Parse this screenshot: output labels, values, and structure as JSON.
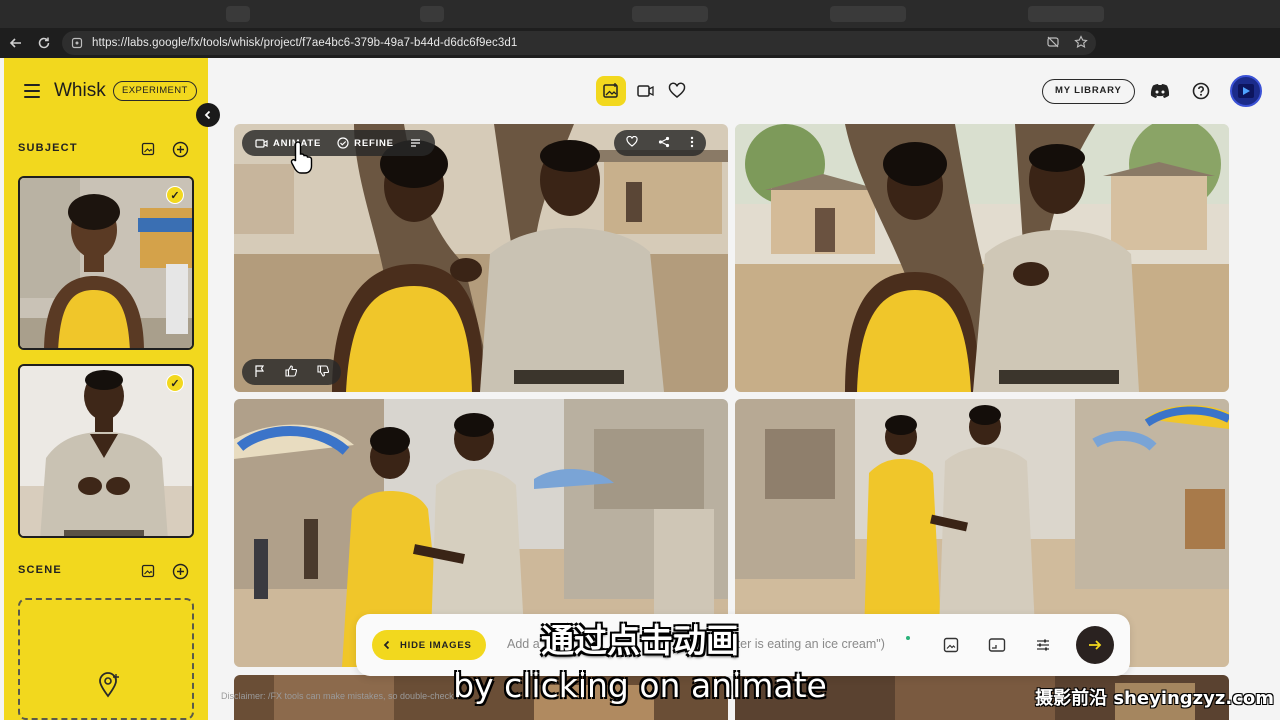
{
  "browser": {
    "url": "https://labs.google/fx/tools/whisk/project/f7ae4bc6-379b-49a7-b44d-d6dc6f9ec3d1",
    "icons": [
      "back-icon",
      "reload-icon",
      "site-info-icon",
      "tracking-prevention-icon",
      "favorite-star-icon",
      "grammarly-icon",
      "extensions-icon",
      "favorites-icon",
      "profile-avatar",
      "more-icon",
      "copilot-icon"
    ]
  },
  "app": {
    "brand": "Whisk",
    "badge": "EXPERIMENT",
    "accent_color": "#f2d81e",
    "sidebar": {
      "subject_title": "SUBJECT",
      "scene_title": "SCENE",
      "subjects": [
        {
          "alt": "woman in yellow dress",
          "selected": true
        },
        {
          "alt": "man in grey shirt",
          "selected": true
        }
      ]
    },
    "topbar": {
      "modes": [
        "image-mode-icon",
        "video-mode-icon",
        "favorites-heart-icon"
      ],
      "active_mode": "image-mode-icon",
      "my_library": "MY LIBRARY"
    },
    "image_toolbar": {
      "animate": "ANIMATE",
      "refine": "REFINE"
    },
    "prompt": {
      "hide_images": "HIDE IMAGES",
      "placeholder_left": "Add a",
      "placeholder_right": "ter is eating an ice cream\")"
    },
    "disclaimer": "Disclaimer: /FX tools can make mistakes, so double-check"
  },
  "overlay": {
    "subtitle_cn": "通过点击动画",
    "subtitle_en": "by clicking on animate",
    "watermark": "摄影前沿 sheyingzyz.com"
  }
}
